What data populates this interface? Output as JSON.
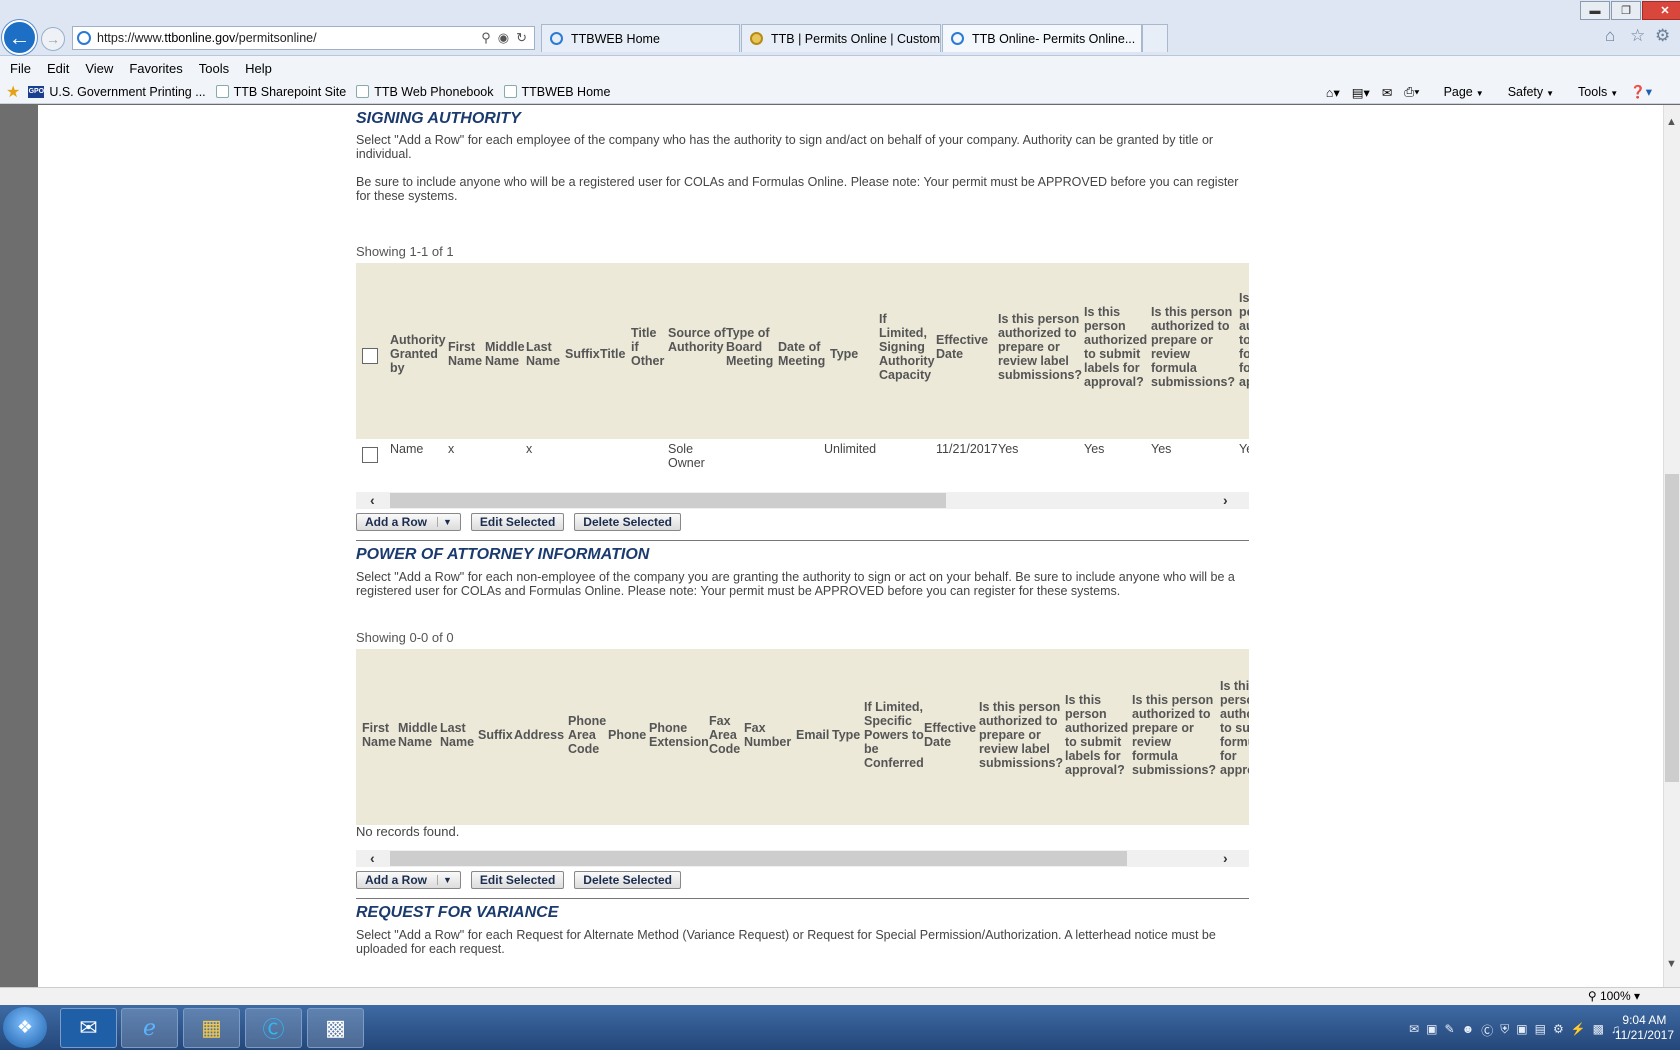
{
  "browser": {
    "url_prefix": "https://www.",
    "url_domain": "ttbonline.gov",
    "url_path": "/permitsonline/",
    "tabs": [
      {
        "label": "TTBWEB Home"
      },
      {
        "label": "TTB | Permits Online | Custom..."
      },
      {
        "label": "TTB Online- Permits Online..."
      }
    ],
    "menu": [
      "File",
      "Edit",
      "View",
      "Favorites",
      "Tools",
      "Help"
    ],
    "favorites": [
      "U.S. Government Printing ...",
      "TTB Sharepoint Site",
      "TTB Web Phonebook",
      "TTBWEB Home"
    ],
    "command_bar": [
      "Page",
      "Safety",
      "Tools"
    ],
    "zoom": "100%"
  },
  "signing": {
    "title": "SIGNING AUTHORITY",
    "desc1": "Select \"Add a Row\" for each employee of the company who has the authority to sign and/act on behalf of your company. Authority can be granted by title or individual.",
    "desc2": "Be sure to include anyone who will be a registered user for COLAs and Formulas Online. Please note: Your permit must be APPROVED before you can register for these systems.",
    "showing": "Showing 1-1 of 1",
    "headers": [
      "Authority Granted by",
      "First Name",
      "Middle Name",
      "Last Name",
      "Suffix",
      "Title",
      "Title if Other",
      "Source of Authority",
      "Type of Board Meeting",
      "Date of Meeting",
      "Type",
      "If Limited, Signing Authority Capacity",
      "Effective Date",
      "Is this person authorized to prepare or review label submissions?",
      "Is this person authorized to submit labels for approval?",
      "Is this person authorized to prepare or review formula submissions?",
      "Is this person authorized to submit formulas for approval?"
    ],
    "row": {
      "granted_by": "Name",
      "first": "x",
      "last": "x",
      "source": "Sole Owner",
      "type": "Unlimited",
      "effective": "11/21/2017",
      "label_prep": "Yes",
      "label_submit": "Yes",
      "formula_prep": "Yes",
      "formula_submit": "Yes"
    },
    "buttons": {
      "add": "Add a Row",
      "edit": "Edit Selected",
      "delete": "Delete Selected"
    }
  },
  "poa": {
    "title": "POWER OF ATTORNEY INFORMATION",
    "desc": "Select \"Add a Row\" for each non-employee of the company you are granting the authority to sign or act on your behalf. Be sure to include anyone who will be a registered user for COLAs and Formulas Online. Please note: Your permit must be APPROVED before you can register for these systems.",
    "showing": "Showing 0-0 of 0",
    "headers": [
      "First Name",
      "Middle Name",
      "Last Name",
      "Suffix",
      "Address",
      "Phone Area Code",
      "Phone",
      "Phone Extension",
      "Fax Area Code",
      "Fax Number",
      "Email",
      "Type",
      "If Limited, Specific Powers to be Conferred",
      "Effective Date",
      "Is this person authorized to prepare or review label submissions?",
      "Is this person authorized to submit labels for approval?",
      "Is this person authorized to prepare or review formula submissions?",
      "Is this person authorized to submit formulas for approval?"
    ],
    "no_records": "No records found.",
    "buttons": {
      "add": "Add a Row",
      "edit": "Edit Selected",
      "delete": "Delete Selected"
    }
  },
  "variance": {
    "title": "REQUEST FOR VARIANCE",
    "desc": "Select \"Add a Row\" for each Request for Alternate Method (Variance Request) or Request for Special Permission/Authorization. A letterhead notice must be uploaded for each request."
  },
  "taskbar": {
    "time": "9:04 AM",
    "date": "11/21/2017"
  }
}
